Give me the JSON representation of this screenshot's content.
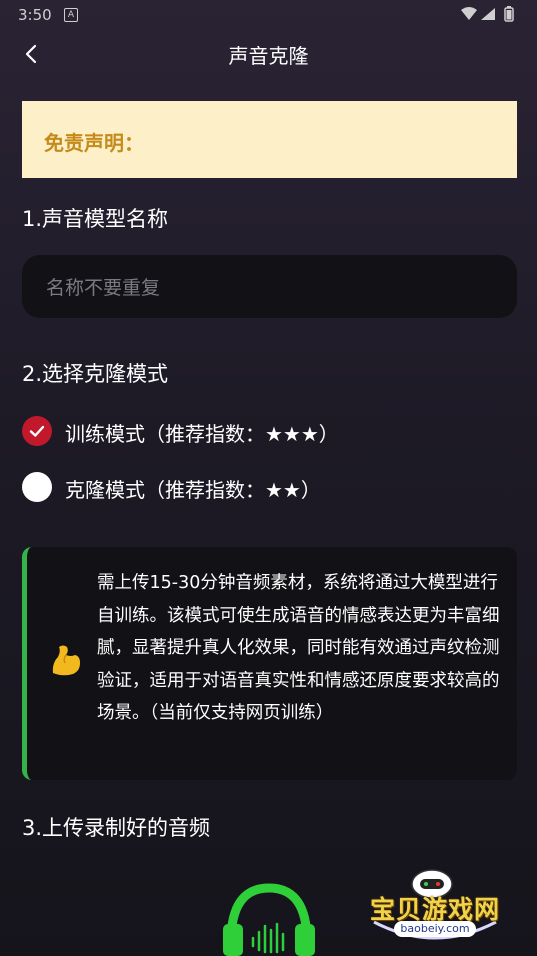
{
  "status_bar": {
    "time": "3:50",
    "notification_icon": "A"
  },
  "header": {
    "title": "声音克隆"
  },
  "disclaimer": {
    "label": "免责声明："
  },
  "section_name": {
    "title": "1.声音模型名称",
    "placeholder": "名称不要重复",
    "value": ""
  },
  "section_mode": {
    "title": "2.选择克隆模式",
    "options": [
      {
        "label": "训练模式（推荐指数：★★★）",
        "checked": true
      },
      {
        "label": "克隆模式（推荐指数：★★）",
        "checked": false
      }
    ]
  },
  "info_card": {
    "icon": "flexed-biceps-emoji",
    "text": "需上传15-30分钟音频素材，系统将通过大模型进行自训练。该模式可使生成语音的情感表达更为丰富细腻，显著提升真人化效果，同时能有效通过声纹检测验证，适用于对语音真实性和情感还原度要求较高的场景。（当前仅支持网页训练）"
  },
  "section_upload": {
    "title": "3.上传录制好的音频",
    "icon": "headphones-audio-icon"
  },
  "watermark": {
    "text": "宝贝游戏网",
    "subtext": "baobeiy.com"
  },
  "colors": {
    "accent_red": "#c2182c",
    "accent_green": "#35b34a",
    "disclaimer_bg": "#fdf0c8",
    "disclaimer_text": "#c68a1a"
  }
}
